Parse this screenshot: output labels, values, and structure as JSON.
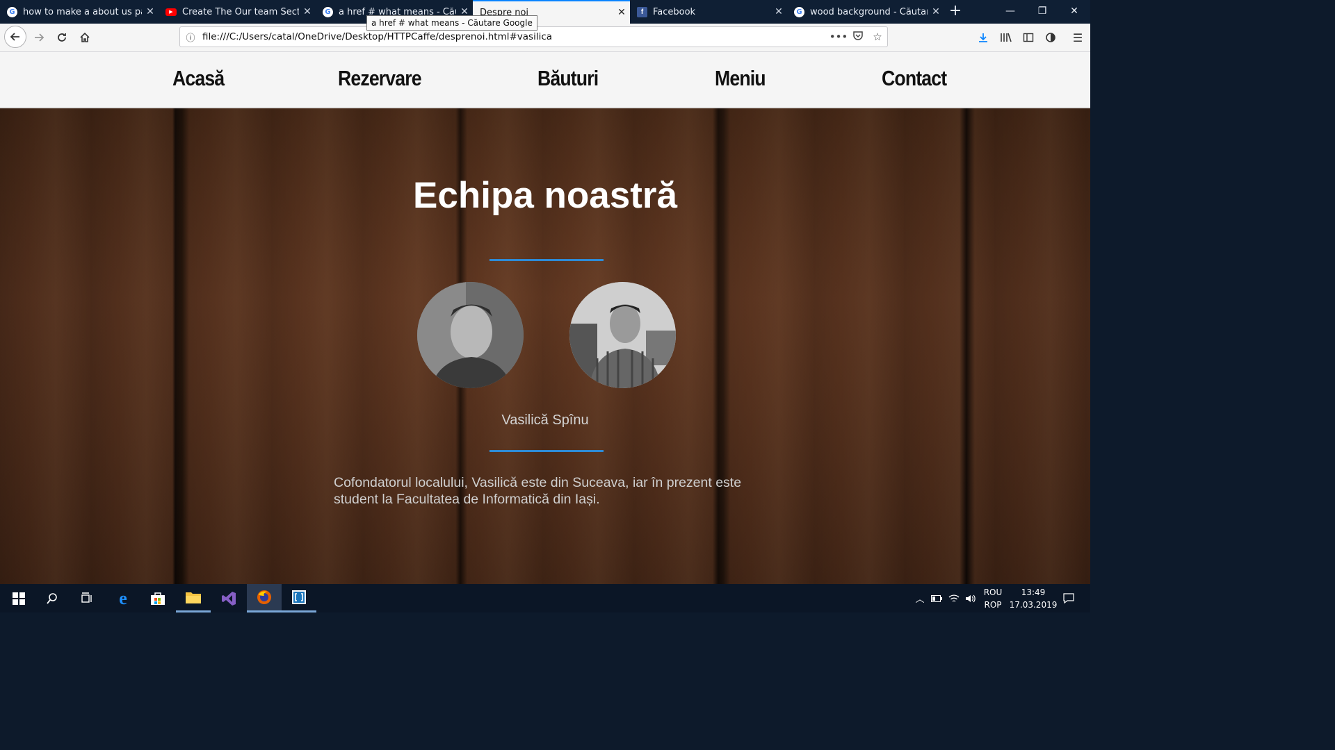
{
  "browser": {
    "tabs": [
      {
        "title": "how to make a about us page",
        "favicon": "google-icon"
      },
      {
        "title": "Create The Our team Section B",
        "favicon": "youtube-icon"
      },
      {
        "title": "a href # what means - Căutare",
        "favicon": "google-icon"
      },
      {
        "title": "Despre noi",
        "favicon": "none",
        "active": true
      },
      {
        "title": "Facebook",
        "favicon": "facebook-icon"
      },
      {
        "title": "wood background - Căutare G",
        "favicon": "google-icon"
      }
    ],
    "tooltip": "a href # what means - Căutare Google",
    "url": "file:///C:/Users/catal/OneDrive/Desktop/HTTPCaffe/desprenoi.html#vasilica",
    "accent": "#0a84ff"
  },
  "site": {
    "nav": [
      "Acasă",
      "Rezervare",
      "Băuturi",
      "Meniu",
      "Contact"
    ],
    "team_title": "Echipa noastră",
    "member_name": "Vasilică Spînu",
    "member_bio": "Cofondatorul localului, Vasilică este din Suceava, iar în prezent este student la Facultatea de Informatică din Iași.",
    "accent": "#2e8bd6"
  },
  "taskbar": {
    "lang_top": "ROU",
    "lang_bottom": "ROP",
    "time": "13:49",
    "date": "17.03.2019"
  }
}
